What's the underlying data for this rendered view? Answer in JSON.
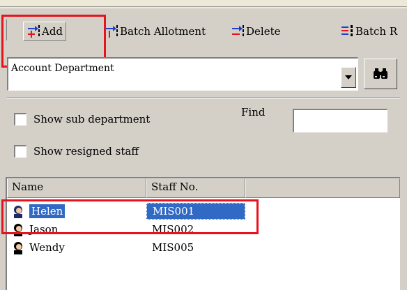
{
  "toolbar": {
    "add_label": "Add",
    "batch_allotment_label": "Batch Allotment",
    "delete_label": "Delete",
    "batch_more_label": "Batch R"
  },
  "department": {
    "selected": "Account Department"
  },
  "filters": {
    "show_sub_department": "Show sub department",
    "show_resigned_staff": "Show resigned staff",
    "find_label": "Find",
    "find_value": ""
  },
  "staff_list": {
    "columns": [
      "Name",
      "Staff No."
    ],
    "rows": [
      {
        "name": "Helen",
        "staff_no": "MIS001",
        "selected": true
      },
      {
        "name": "Jason",
        "staff_no": "MIS002",
        "selected": false
      },
      {
        "name": "Wendy",
        "staff_no": "MIS005",
        "selected": false
      }
    ]
  },
  "colors": {
    "highlight_box": "#e5131d",
    "selection": "#316ac5",
    "window_bg": "#d4d0c8"
  },
  "icons": {
    "add": "add-staff-icon",
    "batch_allotment": "batch-allotment-icon",
    "delete": "delete-staff-icon",
    "batch_more": "batch-icon",
    "search": "binoculars-icon",
    "person": "person-icon"
  }
}
